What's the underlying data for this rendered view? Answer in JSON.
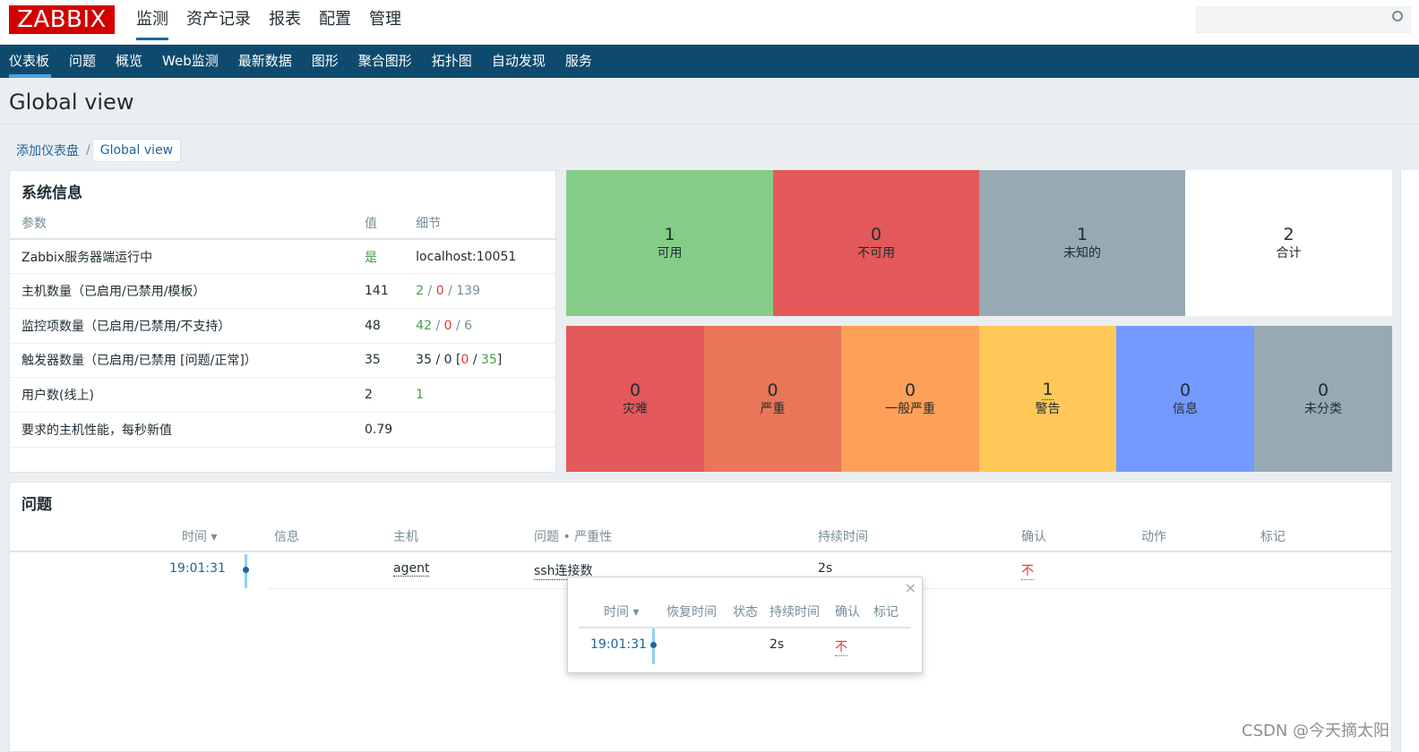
{
  "header": {
    "logo": "ZABBIX",
    "menu": [
      "监测",
      "资产记录",
      "报表",
      "配置",
      "管理"
    ],
    "active_menu": 0
  },
  "subnav": {
    "items": [
      "仪表板",
      "问题",
      "概览",
      "Web监测",
      "最新数据",
      "图形",
      "聚合图形",
      "拓扑图",
      "自动发现",
      "服务"
    ],
    "active": 0
  },
  "page": {
    "title": "Global view"
  },
  "breadcrumb": {
    "parent": "添加仪表盘",
    "sep": "/",
    "current": "Global view"
  },
  "sysinfo": {
    "title": "系统信息",
    "columns": [
      "参数",
      "值",
      "细节"
    ],
    "rows": [
      {
        "param": "Zabbix服务器端运行中",
        "value": "是",
        "detail": "localhost:10051"
      },
      {
        "param": "主机数量（已启用/已禁用/模板）",
        "value": "141",
        "d1": "2",
        "d2": "0",
        "d3": "139"
      },
      {
        "param": "监控项数量（已启用/已禁用/不支持）",
        "value": "48",
        "d1": "42",
        "d2": "0",
        "d3": "6"
      },
      {
        "param": "触发器数量（已启用/已禁用 [问题/正常]）",
        "value": "35",
        "d1": "35",
        "d2": "0",
        "d3": "0",
        "d4": "35"
      },
      {
        "param": "用户数(线上)",
        "value": "2",
        "detail": "1"
      },
      {
        "param": "要求的主机性能，每秒新值",
        "value": "0.79",
        "detail": ""
      }
    ]
  },
  "host_availability": [
    {
      "count": "1",
      "label": "可用",
      "color": "#86cc89"
    },
    {
      "count": "0",
      "label": "不可用",
      "color": "#e45959"
    },
    {
      "count": "1",
      "label": "未知的",
      "color": "#97aab3"
    },
    {
      "count": "2",
      "label": "合计",
      "color": "#ffffff"
    }
  ],
  "problems_by_severity": [
    {
      "count": "0",
      "label": "灾难",
      "color": "#e45959"
    },
    {
      "count": "0",
      "label": "严重",
      "color": "#e97659"
    },
    {
      "count": "0",
      "label": "一般严重",
      "color": "#ffa059"
    },
    {
      "count": "1",
      "label": "警告",
      "color": "#ffc859"
    },
    {
      "count": "0",
      "label": "信息",
      "color": "#7499ff"
    },
    {
      "count": "0",
      "label": "未分类",
      "color": "#97aab3"
    }
  ],
  "problems": {
    "title": "问题",
    "columns": [
      "时间 ▾",
      "信息",
      "主机",
      "问题 • 严重性",
      "持续时间",
      "确认",
      "动作",
      "标记"
    ],
    "row": {
      "time": "19:01:31",
      "host": "agent",
      "problem": "ssh连接数",
      "duration": "2s",
      "ack": "不"
    }
  },
  "popup": {
    "columns": [
      "时间 ▾",
      "恢复时间",
      "状态",
      "持续时间",
      "确认",
      "标记"
    ],
    "row": {
      "time": "19:01:31",
      "duration": "2s",
      "ack": "不"
    }
  },
  "watermark": "CSDN @今天摘太阳"
}
